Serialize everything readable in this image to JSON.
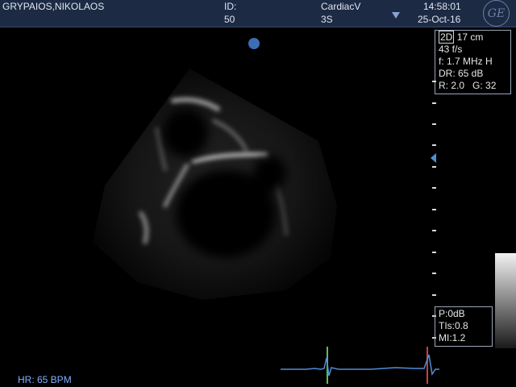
{
  "header": {
    "patient_name": "GRYPAIOS,NIKOLAOS",
    "id_label": "ID:",
    "id_value": "50",
    "preset": "CardiacV",
    "probe": "3S",
    "time": "14:58:01",
    "date": "25-Oct-16",
    "logo_text": "GE",
    "logo_icon": "ge-logo-icon"
  },
  "params": {
    "mode": "2D",
    "depth": "17 cm",
    "frame_rate": "43 f/s",
    "frequency": "f: 1.7 MHz H",
    "dynamic_range": "DR: 65 dB",
    "r": "R: 2.0",
    "g": "G: 32"
  },
  "safety": {
    "power": "P:0dB",
    "tis": "TIs:0.8",
    "mi": "MI:1.2"
  },
  "ecg": {
    "heart_rate": "HR: 65 BPM"
  },
  "colors": {
    "header_bg": "#1d2a44",
    "marker_blue": "#3c6eb8",
    "ecg_trace": "#4f8ed6",
    "ecg_marker_green": "#5cc05c",
    "ecg_marker_red": "#c84040"
  },
  "icons": {
    "orientation": "orientation-dot-icon",
    "focus": "focus-marker-icon",
    "dropdown": "dropdown-arrow-icon"
  }
}
